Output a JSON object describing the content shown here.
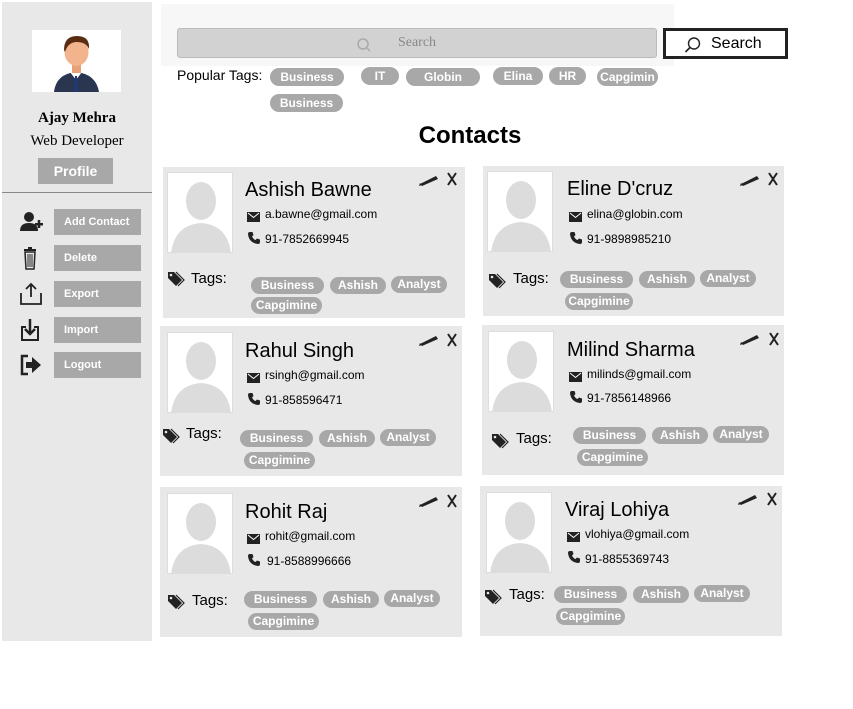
{
  "user": {
    "name": "Ajay Mehra",
    "role": "Web Developer",
    "profile_label": "Profile"
  },
  "sidebar": {
    "items": [
      {
        "label": "Add Contact",
        "icon": "add-user-icon"
      },
      {
        "label": "Delete",
        "icon": "trash-icon"
      },
      {
        "label": "Export",
        "icon": "export-icon"
      },
      {
        "label": "Import",
        "icon": "import-icon"
      },
      {
        "label": "Logout",
        "icon": "logout-icon"
      }
    ]
  },
  "search": {
    "placeholder": "Search",
    "button_label": "Search"
  },
  "popular_tags": {
    "label": "Popular Tags:",
    "tags": [
      "Business",
      "IT",
      "Globin",
      "Elina",
      "HR",
      "Capgimin",
      "Business"
    ]
  },
  "heading": "Contacts",
  "contacts": [
    {
      "name": "Ashish Bawne",
      "email": "a.bawne@gmail.com",
      "phone": "91-7852669945",
      "tags_label": "Tags:",
      "tags": [
        "Business",
        "Ashish",
        "Analyst",
        "Capgimine"
      ]
    },
    {
      "name": "Eline D'cruz",
      "email": "elina@globin.com",
      "phone": "91-9898985210",
      "tags_label": "Tags:",
      "tags": [
        "Business",
        "Ashish",
        "Analyst",
        "Capgimine"
      ]
    },
    {
      "name": "Rahul Singh",
      "email": "rsingh@gmail.com",
      "phone": "91-858596471",
      "tags_label": "Tags:",
      "tags": [
        "Business",
        "Ashish",
        "Analyst",
        "Capgimine"
      ]
    },
    {
      "name": "Milind Sharma",
      "email": "milinds@gmail.com",
      "phone": "91-7856148966",
      "tags_label": "Tags:",
      "tags": [
        "Business",
        "Ashish",
        "Analyst",
        "Capgimine"
      ]
    },
    {
      "name": "Rohit Raj",
      "email": "rohit@gmail.com",
      "phone": "91-8588996666",
      "tags_label": "Tags:",
      "tags": [
        "Business",
        "Ashish",
        "Analyst",
        "Capgimine"
      ]
    },
    {
      "name": "Viraj Lohiya",
      "email": "vlohiya@gmail.com",
      "phone": "91-8855369743",
      "tags_label": "Tags:",
      "tags": [
        "Business",
        "Ashish",
        "Analyst",
        "Capgimine"
      ]
    }
  ],
  "icons": {
    "edit": "pencil-icon",
    "delete": "scissors-icon",
    "email": "mail-icon",
    "phone": "phone-icon",
    "tags": "tag-icon"
  },
  "colors": {
    "sidebar_bg": "#e8e8e8",
    "button_bg": "#a8a8a8",
    "tag_bg": "#a8a8a8",
    "card_bg": "#e8e8e8"
  }
}
